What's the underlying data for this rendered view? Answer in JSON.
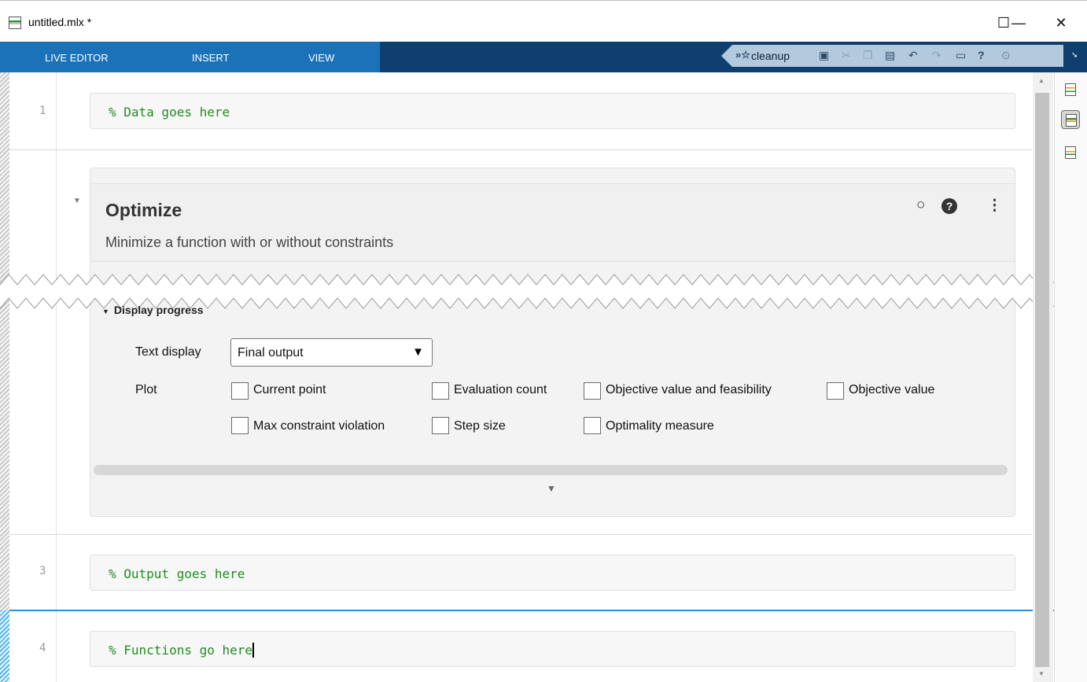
{
  "window": {
    "title": "untitled.mlx *",
    "minimize_glyph": "—",
    "maximize_glyph": "☐",
    "close_glyph": "✕"
  },
  "ribbon": {
    "tabs": [
      "LIVE EDITOR",
      "INSERT",
      "VIEW"
    ],
    "quick_access": {
      "shortcut_label": "cleanup",
      "icons": [
        "cleanup-shortcut-icon",
        "save-icon",
        "cut-icon",
        "copy-icon",
        "paste-icon",
        "undo-icon",
        "redo-icon",
        "window-layout-icon",
        "help-icon",
        "options-icon"
      ]
    },
    "collapse_glyph": "➘"
  },
  "editor": {
    "line_numbers": [
      "1",
      "3",
      "4"
    ],
    "lines": {
      "line1": "% Data goes here",
      "line3": "% Output goes here",
      "line4": "% Functions go here"
    }
  },
  "task": {
    "title": "Optimize",
    "subtitle": "Minimize a function with or without constraints",
    "collapse_glyph": "▼",
    "section_heading": "Display progress",
    "text_display_label": "Text display",
    "text_display_value": "Final output",
    "plot_label": "Plot",
    "plot_options": [
      {
        "label": "Current point",
        "checked": false
      },
      {
        "label": "Evaluation count",
        "checked": false
      },
      {
        "label": "Objective value and feasibility",
        "checked": false
      },
      {
        "label": "Objective value",
        "checked": false
      },
      {
        "label": "Max constraint violation",
        "checked": false
      },
      {
        "label": "Step size",
        "checked": false
      },
      {
        "label": "Optimality measure",
        "checked": false
      }
    ],
    "expand_glyph": "▼"
  },
  "colors": {
    "ribbon_blue": "#1b72b9",
    "ribbon_dark": "#0e3f6f",
    "code_comment": "#228b22",
    "selection_blue": "#2d8fd8"
  }
}
